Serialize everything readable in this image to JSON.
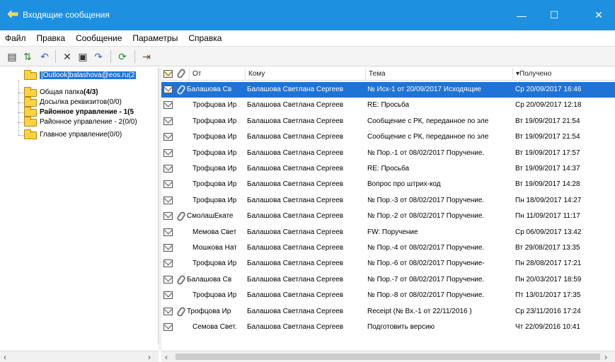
{
  "window": {
    "title": "Входящие сообщения",
    "minimize": "—",
    "maximize": "☐",
    "close": "✕"
  },
  "menu": [
    "Файл",
    "Правка",
    "Сообщение",
    "Параметры",
    "Справка"
  ],
  "toolbar": {
    "icons": [
      "new-doc-icon",
      "send-receive-icon",
      "reply-icon",
      "delete-icon",
      "move-icon",
      "forward-icon",
      "refresh-icon",
      "exit-icon"
    ],
    "glyphs": [
      "▤",
      "⇅",
      "↶",
      "✕",
      "▣",
      "↷",
      "⟳",
      "⇥"
    ]
  },
  "tree": {
    "root": "[Outlook]balashova@eos.ru(2",
    "items": [
      {
        "label": "Общая папка",
        "count": "(4/3)",
        "bold": false,
        "countBold": true
      },
      {
        "label": "Досылка реквизитов(0/0)",
        "count": "",
        "bold": false,
        "countBold": false
      },
      {
        "label": "Районное управление - 1(5",
        "count": "",
        "bold": true,
        "countBold": false
      },
      {
        "label": "Районное управление - 2(0/0)",
        "count": "",
        "bold": false,
        "countBold": false
      },
      {
        "label": "Главное управление(0/0)",
        "count": "",
        "bold": false,
        "countBold": false
      }
    ]
  },
  "columns": {
    "from": "От",
    "to": "Кому",
    "subject": "Тема",
    "received": "Получено",
    "sort_indicator": "▾"
  },
  "messages": [
    {
      "from": "Балашова Св",
      "to": "Балашова Светлана Сергеев",
      "subject": "№ Исх-1 от 20/09/2017 Исходящие",
      "received": "Ср 20/09/2017 16:46",
      "attach": true,
      "selected": true
    },
    {
      "from": "Трофцова Ир",
      "to": "Балашова Светлана Сергеев",
      "subject": "RE: Просьба",
      "received": "Ср 20/09/2017 12:18",
      "attach": false,
      "selected": false
    },
    {
      "from": "Трофцова Ир",
      "to": "Балашова Светлана Сергеев",
      "subject": "Сообщение с РК, переданное по эле",
      "received": "Вт 19/09/2017 21:54",
      "attach": false,
      "selected": false
    },
    {
      "from": "Трофцова Ир",
      "to": "Балашова Светлана Сергеев",
      "subject": "Сообщение с РК, переданное по эле",
      "received": "Вт 19/09/2017 21:54",
      "attach": false,
      "selected": false
    },
    {
      "from": "Трофцова Ир",
      "to": "Балашова Светлана Сергеев",
      "subject": "№ Пор.-1 от 08/02/2017 Поручение.",
      "received": "Вт 19/09/2017 17:57",
      "attach": false,
      "selected": false
    },
    {
      "from": "Трофцова Ир",
      "to": "Балашова Светлана Сергеев",
      "subject": "RE: Просьба",
      "received": "Вт 19/09/2017 14:37",
      "attach": false,
      "selected": false
    },
    {
      "from": "Трофцова Ир",
      "to": "Балашова Светлана Сергеев",
      "subject": "Вопрос про штрих-код",
      "received": "Вт 19/09/2017 14:28",
      "attach": false,
      "selected": false
    },
    {
      "from": "Трофцова Ир",
      "to": "Балашова Светлана Сергеев",
      "subject": "№ Пор.-3 от 08/02/2017 Поручение.",
      "received": "Пн 18/09/2017 14:27",
      "attach": false,
      "selected": false
    },
    {
      "from": "СмолашЕкате",
      "to": "Балашова Светлана Сергеев",
      "subject": "№ Пор.-2 от 08/02/2017 Поручение.",
      "received": "Пн 11/09/2017 11:17",
      "attach": true,
      "selected": false
    },
    {
      "from": "Мемова Свет",
      "to": "Балашова Светлана Сергеев",
      "subject": "FW: Поручение",
      "received": "Ср 06/09/2017 13:42",
      "attach": false,
      "selected": false
    },
    {
      "from": "Мошкова Нат",
      "to": "Балашова Светлана Сергеев",
      "subject": "№ Пор.-4 от 08/02/2017 Поручение.",
      "received": "Вт 29/08/2017 13:35",
      "attach": false,
      "selected": false
    },
    {
      "from": "Трофцова Ир",
      "to": "Балашова Светлана Сергеев",
      "subject": "№ Пор.-6 от 08/02/2017 Поручение-",
      "received": "Пн 28/08/2017 17:21",
      "attach": false,
      "selected": false
    },
    {
      "from": "Балашова Св",
      "to": "Балашова Светлана Сергеев",
      "subject": "№ Пор.-7 от 08/02/2017 Поручение.",
      "received": "Пн 20/03/2017 18:59",
      "attach": true,
      "selected": false
    },
    {
      "from": "Трофцова Ир",
      "to": "Балашова Светлана Сергеев",
      "subject": "№ Пор.-8 от 08/02/2017 Поручение.",
      "received": "Пт 13/01/2017 17:35",
      "attach": false,
      "selected": false
    },
    {
      "from": "Трофцова Ир",
      "to": "Балашова Светлана Сергеев",
      "subject": "Receipt (№ Вх.-1 от 22/11/2016 )",
      "received": "Ср 23/11/2016 17:24",
      "attach": true,
      "selected": false
    },
    {
      "from": "Семова Свет.",
      "to": "Балашова Светлана Сергеев",
      "subject": "Подготовить версию",
      "received": "Чт 22/09/2016 10:41",
      "attach": false,
      "selected": false
    }
  ],
  "scrollbars": {
    "left": "‹",
    "right": "›"
  },
  "colors": {
    "titlebar": "#1e90e0",
    "selection": "#1f73d6",
    "folder": "#ffd23f"
  }
}
